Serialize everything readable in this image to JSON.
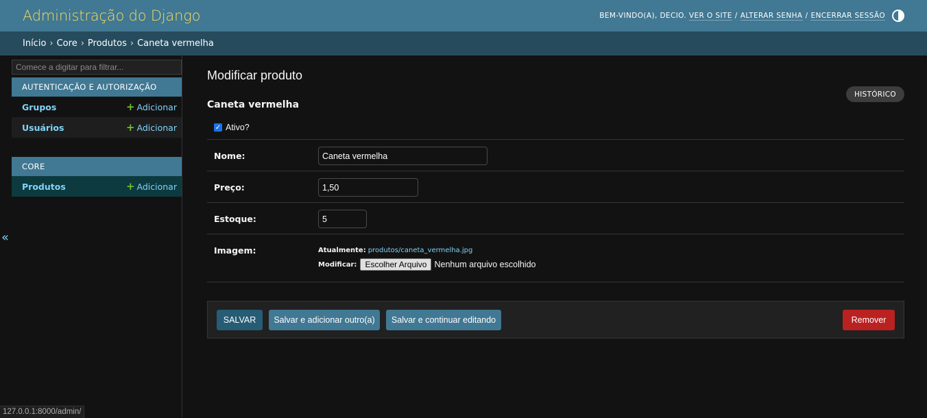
{
  "header": {
    "branding": "Administração do Django",
    "welcome": "Bem-vindo(a),",
    "username": "Decio.",
    "links": [
      "Ver o site",
      "Alterar senha",
      "Encerrar sessão"
    ],
    "separator": "/"
  },
  "breadcrumbs": {
    "items": [
      "Início",
      "Core",
      "Produtos",
      "Caneta vermelha"
    ],
    "separator": "›"
  },
  "sidebar": {
    "filter_placeholder": "Comece a digitar para filtrar...",
    "modules": [
      {
        "caption": "Autenticação e Autorização",
        "models": [
          {
            "name": "Grupos",
            "add_label": "Adicionar"
          },
          {
            "name": "Usuários",
            "add_label": "Adicionar"
          }
        ]
      },
      {
        "caption": "Core",
        "models": [
          {
            "name": "Produtos",
            "add_label": "Adicionar"
          }
        ]
      }
    ],
    "collapse_glyph": "«"
  },
  "content": {
    "title": "Modificar produto",
    "history_label": "Histórico",
    "object_name": "Caneta vermelha",
    "active_label": "Ativo?",
    "active_checked": true,
    "fields": {
      "nome": {
        "label": "Nome:",
        "value": "Caneta vermelha"
      },
      "preco": {
        "label": "Preço:",
        "value": "1,50"
      },
      "estoque": {
        "label": "Estoque:",
        "value": "5"
      },
      "imagem": {
        "label": "Imagem:",
        "current_label": "Atualmente:",
        "current_file": "produtos/caneta_vermelha.jpg",
        "change_label": "Modificar:",
        "choose_button": "Escolher Arquivo",
        "no_file": "Nenhum arquivo escolhido"
      }
    },
    "buttons": {
      "save": "Salvar",
      "save_add": "Salvar e adicionar outro(a)",
      "save_continue": "Salvar e continuar editando",
      "delete": "Remover"
    }
  },
  "status_url": "127.0.0.1:8000/admin/",
  "colors": {
    "header": "#417893",
    "breadcrumbs": "#264b5d",
    "branding": "#f5dd5d",
    "link": "#81d4fa",
    "add_icon": "#70bf2b",
    "delete": "#ba2121"
  }
}
